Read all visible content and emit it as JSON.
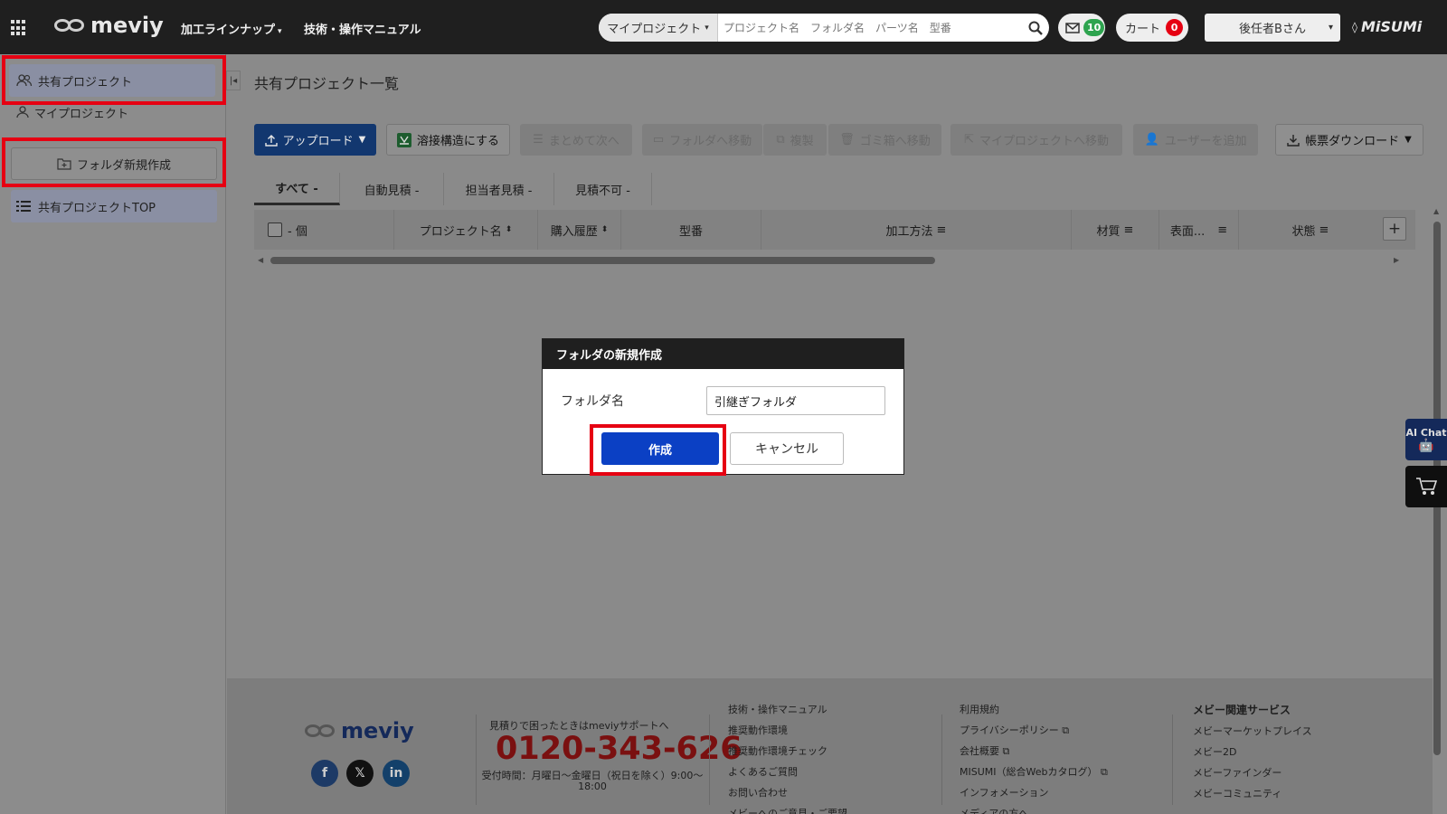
{
  "header": {
    "brand": "meviy",
    "nav": [
      {
        "label": "加工ラインナップ",
        "has_dropdown": true
      },
      {
        "label": "技術・操作マニュアル",
        "has_dropdown": false
      }
    ],
    "search": {
      "scope": "マイプロジェクト",
      "placeholder": "プロジェクト名　フォルダ名　パーツ名　型番"
    },
    "messages_count": "10",
    "cart_label": "カート",
    "cart_count": "0",
    "user": "後任者Bさん",
    "company": "MiSUMi"
  },
  "sidebar": {
    "shared_projects": "共有プロジェクト",
    "my_projects": "マイプロジェクト",
    "new_folder": "フォルダ新規作成",
    "shared_top": "共有プロジェクトTOP"
  },
  "main": {
    "title": "共有プロジェクト一覧",
    "toolbar": {
      "upload": "アップロード",
      "weld": "溶接構造にする",
      "batch_next": "まとめて次へ",
      "move_folder": "フォルダへ移動",
      "copy": "複製",
      "trash": "ゴミ箱へ移動",
      "move_my": "マイプロジェクトへ移動",
      "add_user": "ユーザーを追加",
      "download": "帳票ダウンロード"
    },
    "tabs": [
      "すべて -",
      "自動見積 -",
      "担当者見積 -",
      "見積不可 -"
    ],
    "columns": {
      "count": "- 個",
      "project_name": "プロジェクト名",
      "purchase_history": "購入履歴",
      "model_number": "型番",
      "processing": "加工方法",
      "material": "材質",
      "surface": "表面...",
      "status": "状態"
    }
  },
  "modal": {
    "title": "フォルダの新規作成",
    "label": "フォルダ名",
    "value": "引継ぎフォルダ",
    "create": "作成",
    "cancel": "キャンセル"
  },
  "float": {
    "ai_chat": "AI Chat"
  },
  "footer": {
    "brand": "meviy",
    "support_lead": "見積りで困ったときはmeviyサポートへ",
    "phone": "0120-343-626",
    "hours": "受付時間：月曜日～金曜日（祝日を除く）9:00～18:00",
    "links_col1": [
      "技術・操作マニュアル",
      "推奨動作環境",
      "推奨動作環境チェック",
      "よくあるご質問",
      "お問い合わせ",
      "メビーへのご意見・ご要望"
    ],
    "links_col2": [
      "利用規約",
      "プライバシーポリシー",
      "会社概要",
      "MISUMI（総合Webカタログ）",
      "インフォメーション",
      "メディアの方へ"
    ],
    "links_col3_head": "メビー関連サービス",
    "links_col3": [
      "メビーマーケットプレイス",
      "メビー2D",
      "メビーファインダー",
      "メビーコミュニティ"
    ]
  },
  "colors": {
    "primary_blue": "#0b40c4",
    "highlight_red": "#e60012",
    "header_bg": "#1f1f1f"
  }
}
